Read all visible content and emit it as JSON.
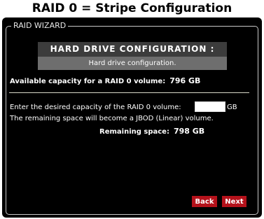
{
  "page": {
    "title": "RAID 0 = Stripe Configuration"
  },
  "wizard": {
    "legend": "RAID WIZARD",
    "header_title": "HARD DRIVE CONFIGURATION :",
    "header_subtitle": "Hard drive configuration.",
    "available_label": "Available capacity for a RAID 0 volume:",
    "available_value": "796 GB",
    "desired_label": "Enter the desired capacity of the RAID 0 volume:",
    "desired_value": "",
    "desired_unit": "GB",
    "remaining_note": "The remaining space will become a JBOD (Linear) volume.",
    "remaining_label": "Remaining space:",
    "remaining_value": "798 GB"
  },
  "buttons": {
    "back_label": "Back",
    "next_label": "Next"
  },
  "colors": {
    "panel_bg": "#000000",
    "header_bg": "#3c3c3c",
    "subheader_bg": "#6e6e6e",
    "button_bg": "#b5121b",
    "text": "#ffffff"
  }
}
